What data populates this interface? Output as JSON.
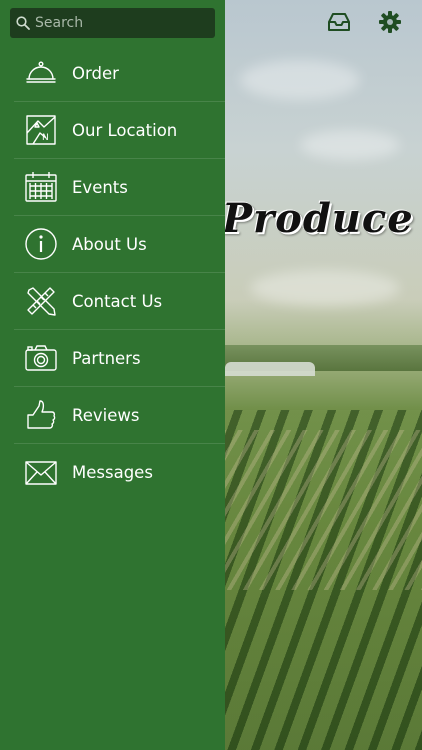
{
  "background": {
    "title": "Produce"
  },
  "topbar": {
    "inbox_icon": "inbox-icon",
    "settings_icon": "gear-icon"
  },
  "drawer": {
    "search": {
      "placeholder": "Search",
      "value": ""
    },
    "items": [
      {
        "label": "Order",
        "icon": "cloche-icon"
      },
      {
        "label": "Our Location",
        "icon": "map-icon"
      },
      {
        "label": "Events",
        "icon": "calendar-icon"
      },
      {
        "label": "About Us",
        "icon": "info-icon"
      },
      {
        "label": "Contact Us",
        "icon": "pencil-ruler-icon"
      },
      {
        "label": "Partners",
        "icon": "camera-icon"
      },
      {
        "label": "Reviews",
        "icon": "thumbs-up-icon"
      },
      {
        "label": "Messages",
        "icon": "envelope-icon"
      }
    ]
  },
  "colors": {
    "drawer_bg": "#2f7330",
    "search_bg": "#1e3d1e",
    "icon_green": "#1f4d22"
  }
}
